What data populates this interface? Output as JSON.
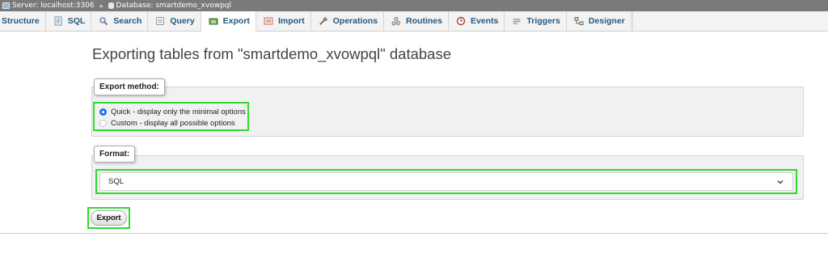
{
  "breadcrumb": {
    "server": "Server: localhost:3306",
    "separator": "»",
    "database": "Database: smartdemo_xvowpql"
  },
  "tabs": [
    {
      "label": "Structure",
      "icon": "structure-icon",
      "active": false
    },
    {
      "label": "SQL",
      "icon": "sql-icon",
      "active": false
    },
    {
      "label": "Search",
      "icon": "search-icon",
      "active": false
    },
    {
      "label": "Query",
      "icon": "query-icon",
      "active": false
    },
    {
      "label": "Export",
      "icon": "export-icon",
      "active": true
    },
    {
      "label": "Import",
      "icon": "import-icon",
      "active": false
    },
    {
      "label": "Operations",
      "icon": "wrench-icon",
      "active": false
    },
    {
      "label": "Routines",
      "icon": "routines-icon",
      "active": false
    },
    {
      "label": "Events",
      "icon": "clock-icon",
      "active": false
    },
    {
      "label": "Triggers",
      "icon": "triggers-icon",
      "active": false
    },
    {
      "label": "Designer",
      "icon": "designer-icon",
      "active": false
    }
  ],
  "page": {
    "title": "Exporting tables from \"smartdemo_xvowpql\" database"
  },
  "export_method": {
    "legend": "Export method:",
    "options": [
      {
        "label": "Quick - display only the minimal options",
        "selected": true
      },
      {
        "label": "Custom - display all possible options",
        "selected": false
      }
    ]
  },
  "format": {
    "legend": "Format:",
    "selected": "SQL"
  },
  "actions": {
    "export_label": "Export"
  },
  "colors": {
    "accent": "#235a81",
    "highlight": "#2edb2e",
    "radio": "#1a73e8"
  }
}
